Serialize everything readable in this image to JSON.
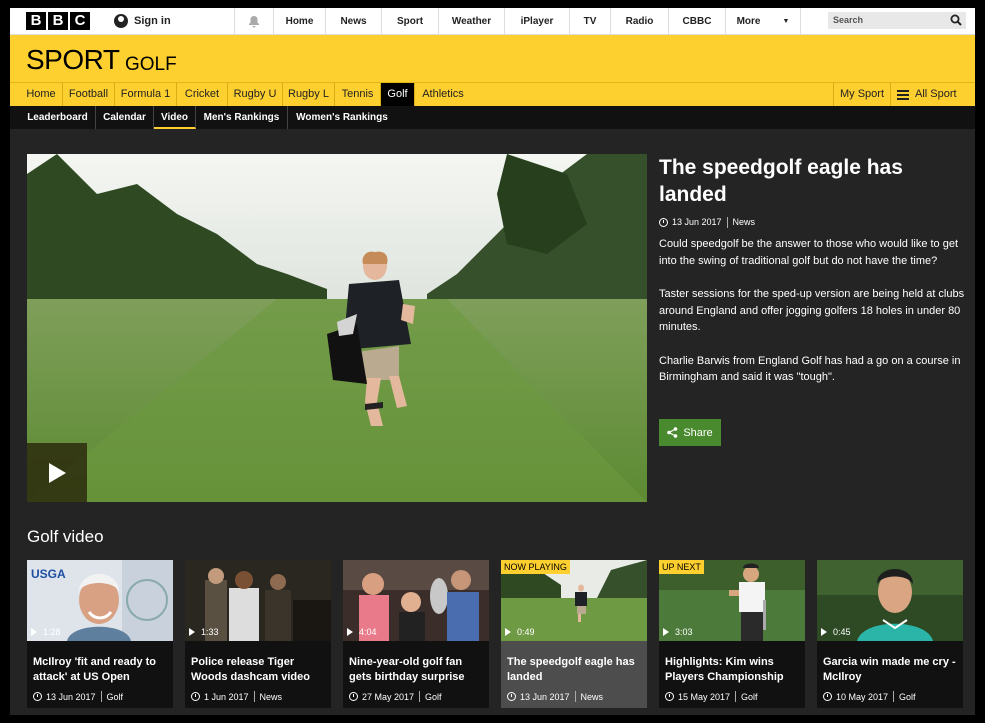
{
  "bbc_bar": {
    "logo_letters": [
      "B",
      "B",
      "C"
    ],
    "sign_in": "Sign in",
    "nav": [
      "Home",
      "News",
      "Sport",
      "Weather",
      "iPlayer",
      "TV",
      "Radio",
      "CBBC",
      "More"
    ],
    "search_placeholder": "Search"
  },
  "header": {
    "sport": "SPORT",
    "section": "GOLF"
  },
  "sport_nav": {
    "items": [
      "Home",
      "Football",
      "Formula 1",
      "Cricket",
      "Rugby U",
      "Rugby L",
      "Tennis",
      "Golf",
      "Athletics"
    ],
    "active": "Golf",
    "my_sport": "My Sport",
    "all_sport": "All Sport"
  },
  "golf_nav": {
    "items": [
      "Leaderboard",
      "Calendar",
      "Video",
      "Men's Rankings",
      "Women's Rankings"
    ],
    "active": "Video"
  },
  "featured": {
    "title": "The speedgolf eagle has landed",
    "date": "13 Jun 2017",
    "category": "News",
    "paragraphs": [
      "Could speedgolf be the answer to those who would like to get into the swing of traditional golf but do not have the time?",
      "Taster sessions for the sped-up version are being held at clubs around England and offer jogging golfers 18 holes in under 80 minutes.",
      "Charlie Barwis from England Golf has had a go on a course in Birmingham and said it was \"tough\"."
    ],
    "share": "Share"
  },
  "video_section": {
    "title": "Golf video",
    "cards": [
      {
        "title": "McIlroy 'fit and ready to attack' at US Open",
        "duration": "1:28",
        "date": "13 Jun 2017",
        "category": "Golf",
        "tag": ""
      },
      {
        "title": "Police release Tiger Woods dashcam video",
        "duration": "1:33",
        "date": "1 Jun 2017",
        "category": "News",
        "tag": ""
      },
      {
        "title": "Nine-year-old golf fan gets birthday surprise",
        "duration": "4:04",
        "date": "27 May 2017",
        "category": "Golf",
        "tag": ""
      },
      {
        "title": "The speedgolf eagle has landed",
        "duration": "0:49",
        "date": "13 Jun 2017",
        "category": "News",
        "tag": "NOW PLAYING"
      },
      {
        "title": "Highlights: Kim wins Players Championship",
        "duration": "3:03",
        "date": "15 May 2017",
        "category": "Golf",
        "tag": "UP NEXT"
      },
      {
        "title": "Garcia win made me cry - McIlroy",
        "duration": "0:45",
        "date": "10 May 2017",
        "category": "Golf",
        "tag": ""
      }
    ]
  },
  "colors": {
    "brand_yellow": "#fed02f",
    "share_green": "#4a8a2f",
    "background": "#242424"
  }
}
